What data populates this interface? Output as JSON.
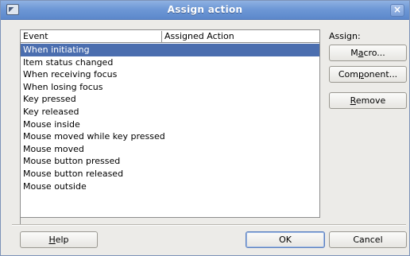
{
  "window": {
    "title": "Assign action",
    "close_glyph": "×"
  },
  "list": {
    "columns": [
      "Event",
      "Assigned Action"
    ],
    "events": [
      "When initiating",
      "Item status changed",
      "When receiving focus",
      "When losing focus",
      "Key pressed",
      "Key released",
      "Mouse inside",
      "Mouse moved while key pressed",
      "Mouse moved",
      "Mouse button pressed",
      "Mouse button released",
      "Mouse outside"
    ],
    "selected_index": 0
  },
  "assign": {
    "label": "Assign:",
    "macro": {
      "pre": "M",
      "key": "a",
      "post": "cro..."
    },
    "component": {
      "pre": "Com",
      "key": "p",
      "post": "onent..."
    },
    "remove": {
      "pre": "",
      "key": "R",
      "post": "emove"
    }
  },
  "footer": {
    "help": {
      "pre": "",
      "key": "H",
      "post": "elp"
    },
    "ok": "OK",
    "cancel": "Cancel"
  },
  "colors": {
    "title_bar": "#6e98d6",
    "selection": "#4b6eaf"
  },
  "icons": {
    "app": "window-menu-icon",
    "close": "close-icon"
  }
}
